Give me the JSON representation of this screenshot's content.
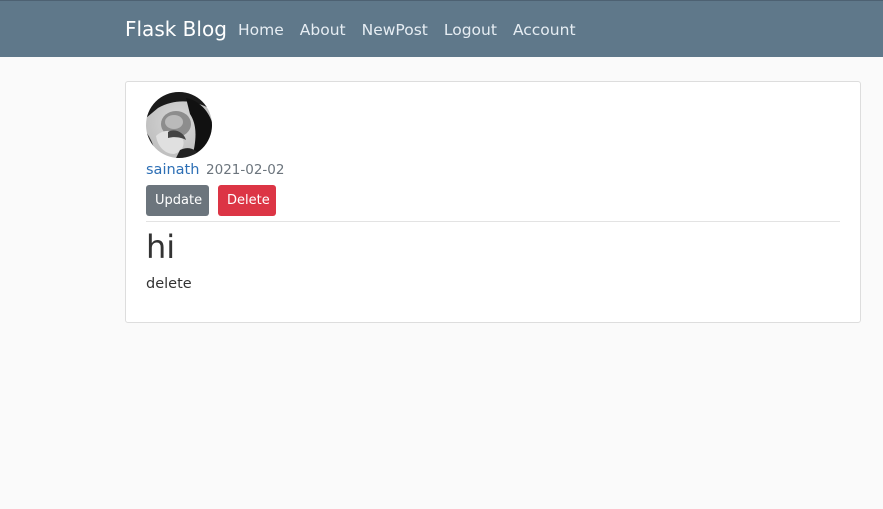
{
  "navbar": {
    "brand": "Flask Blog",
    "links": [
      {
        "label": "Home"
      },
      {
        "label": "About"
      },
      {
        "label": "NewPost"
      },
      {
        "label": "Logout"
      },
      {
        "label": "Account"
      }
    ],
    "background": "#5f788a"
  },
  "post": {
    "author": "sainath",
    "date": "2021-02-02",
    "update_label": "Update",
    "delete_label": "Delete",
    "title": "hi",
    "content": "delete"
  },
  "colors": {
    "update_button": "#6c757d",
    "delete_button": "#dc3545",
    "author_link": "#2d6fb5"
  },
  "icons": {
    "avatar": "user-avatar-photo"
  }
}
